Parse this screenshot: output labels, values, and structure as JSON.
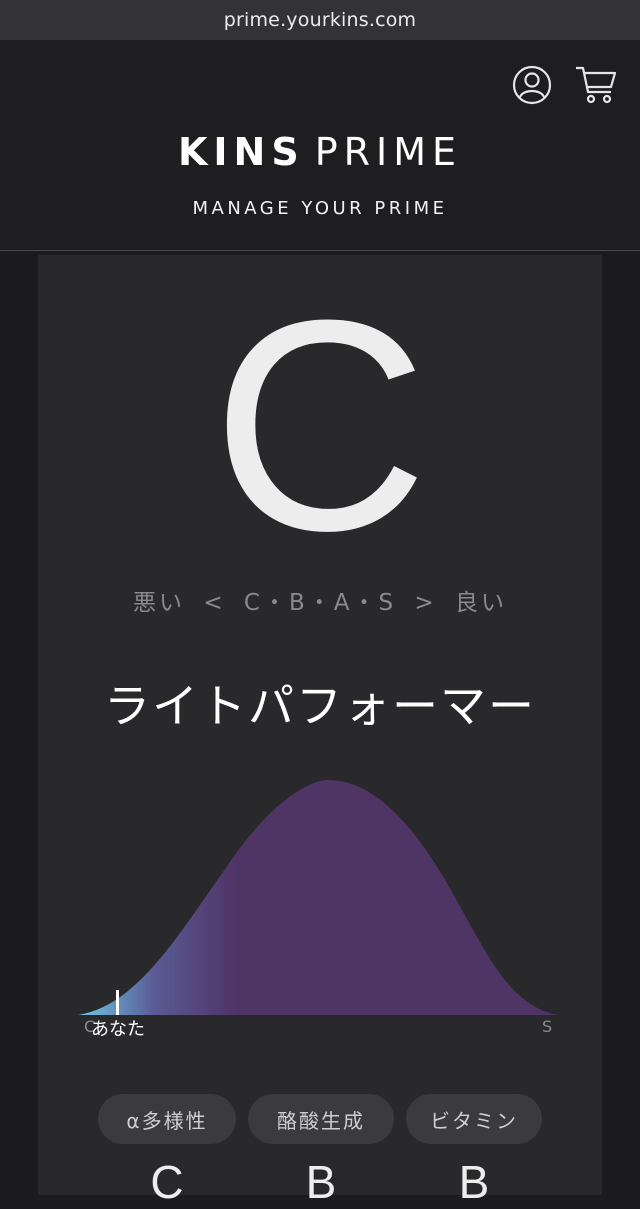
{
  "browser": {
    "url": "prime.yourkins.com"
  },
  "header": {
    "brand_kins": "KINS",
    "brand_prime": "PRIME",
    "subtitle": "MANAGE YOUR PRIME",
    "account_icon": "user-circle-icon",
    "cart_icon": "shopping-cart-icon"
  },
  "result": {
    "grade": "C",
    "scale": {
      "bad": "悪い",
      "left_arrow": "<",
      "grades": "C・B・A・S",
      "right_arrow": ">",
      "good": "良い"
    },
    "type_name": "ライトパフォーマー"
  },
  "chart_data": {
    "type": "area",
    "x_min_label": "C",
    "x_max_label": "S",
    "marker_label": "あなた",
    "marker_position": 0.08,
    "colors": {
      "fill": "#4f3466",
      "gradient_start": "#6fc7e6",
      "gradient_mid": "#5a5a94"
    }
  },
  "categories": [
    {
      "label": "α多様性",
      "grade": "C"
    },
    {
      "label": "酪酸生成",
      "grade": "B"
    },
    {
      "label": "ビタミン",
      "grade": "B"
    }
  ]
}
